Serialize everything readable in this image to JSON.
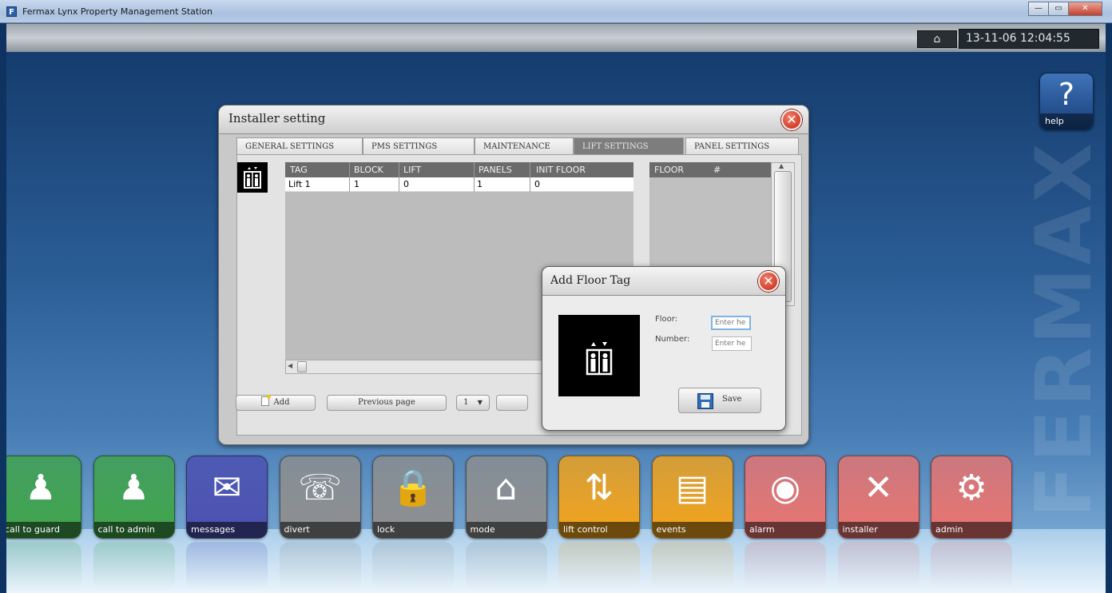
{
  "window": {
    "title": "Fermax Lynx Property Management Station",
    "controls": {
      "minimize": "—",
      "maximize": "▭",
      "close": "✕"
    }
  },
  "statusbar": {
    "datetime": "13-11-06 12:04:55",
    "network_icon": "network-house-icon"
  },
  "desktop": {
    "watermark": "FERMAX",
    "help": {
      "label": "help",
      "glyph": "?"
    }
  },
  "installer_dialog": {
    "title": "Installer setting",
    "tabs": [
      "GENERAL SETTINGS",
      "PMS SETTINGS",
      "MAINTENANCE",
      "LIFT SETTINGS",
      "PANEL SETTINGS"
    ],
    "active_tab": "LIFT SETTINGS",
    "lift_table": {
      "columns": [
        "TAG",
        "BLOCK",
        "LIFT",
        "PANELS",
        "INIT FLOOR"
      ],
      "rows": [
        [
          "Lift 1",
          "1",
          "0",
          "1",
          "0"
        ]
      ]
    },
    "floor_table": {
      "columns": [
        "FLOOR",
        "#"
      ]
    },
    "buttons": {
      "add": "Add",
      "previous_page": "Previous page",
      "page_select": "1",
      "page_select_arrow": "▼"
    }
  },
  "add_floor_dialog": {
    "title": "Add Floor Tag",
    "floor_label": "Floor:",
    "number_label": "Number:",
    "floor_placeholder": "Enter he",
    "number_placeholder": "Enter he",
    "save_label": "Save"
  },
  "launcher": {
    "tiles": [
      {
        "label": "call to guard",
        "icon": "guard-bell-icon",
        "color": "#3fa34a"
      },
      {
        "label": "call to admin",
        "icon": "admin-bell-icon",
        "color": "#3fa34a"
      },
      {
        "label": "messages",
        "icon": "envelope-icon",
        "color": "#4b4fb0"
      },
      {
        "label": "divert",
        "icon": "phone-divert-icon",
        "color": "#8e8e8e"
      },
      {
        "label": "lock",
        "icon": "padlock-icon",
        "color": "#8e8e8e"
      },
      {
        "label": "mode",
        "icon": "house-gear-icon",
        "color": "#8e8e8e"
      },
      {
        "label": "lift control",
        "icon": "lift-icon",
        "color": "#f2a21a"
      },
      {
        "label": "events",
        "icon": "documents-icon",
        "color": "#f2a21a"
      },
      {
        "label": "alarm",
        "icon": "alarm-bell-icon",
        "color": "#e8736f"
      },
      {
        "label": "installer",
        "icon": "tools-icon",
        "color": "#e8736f"
      },
      {
        "label": "admin",
        "icon": "admin-gear-icon",
        "color": "#e8736f"
      }
    ]
  }
}
